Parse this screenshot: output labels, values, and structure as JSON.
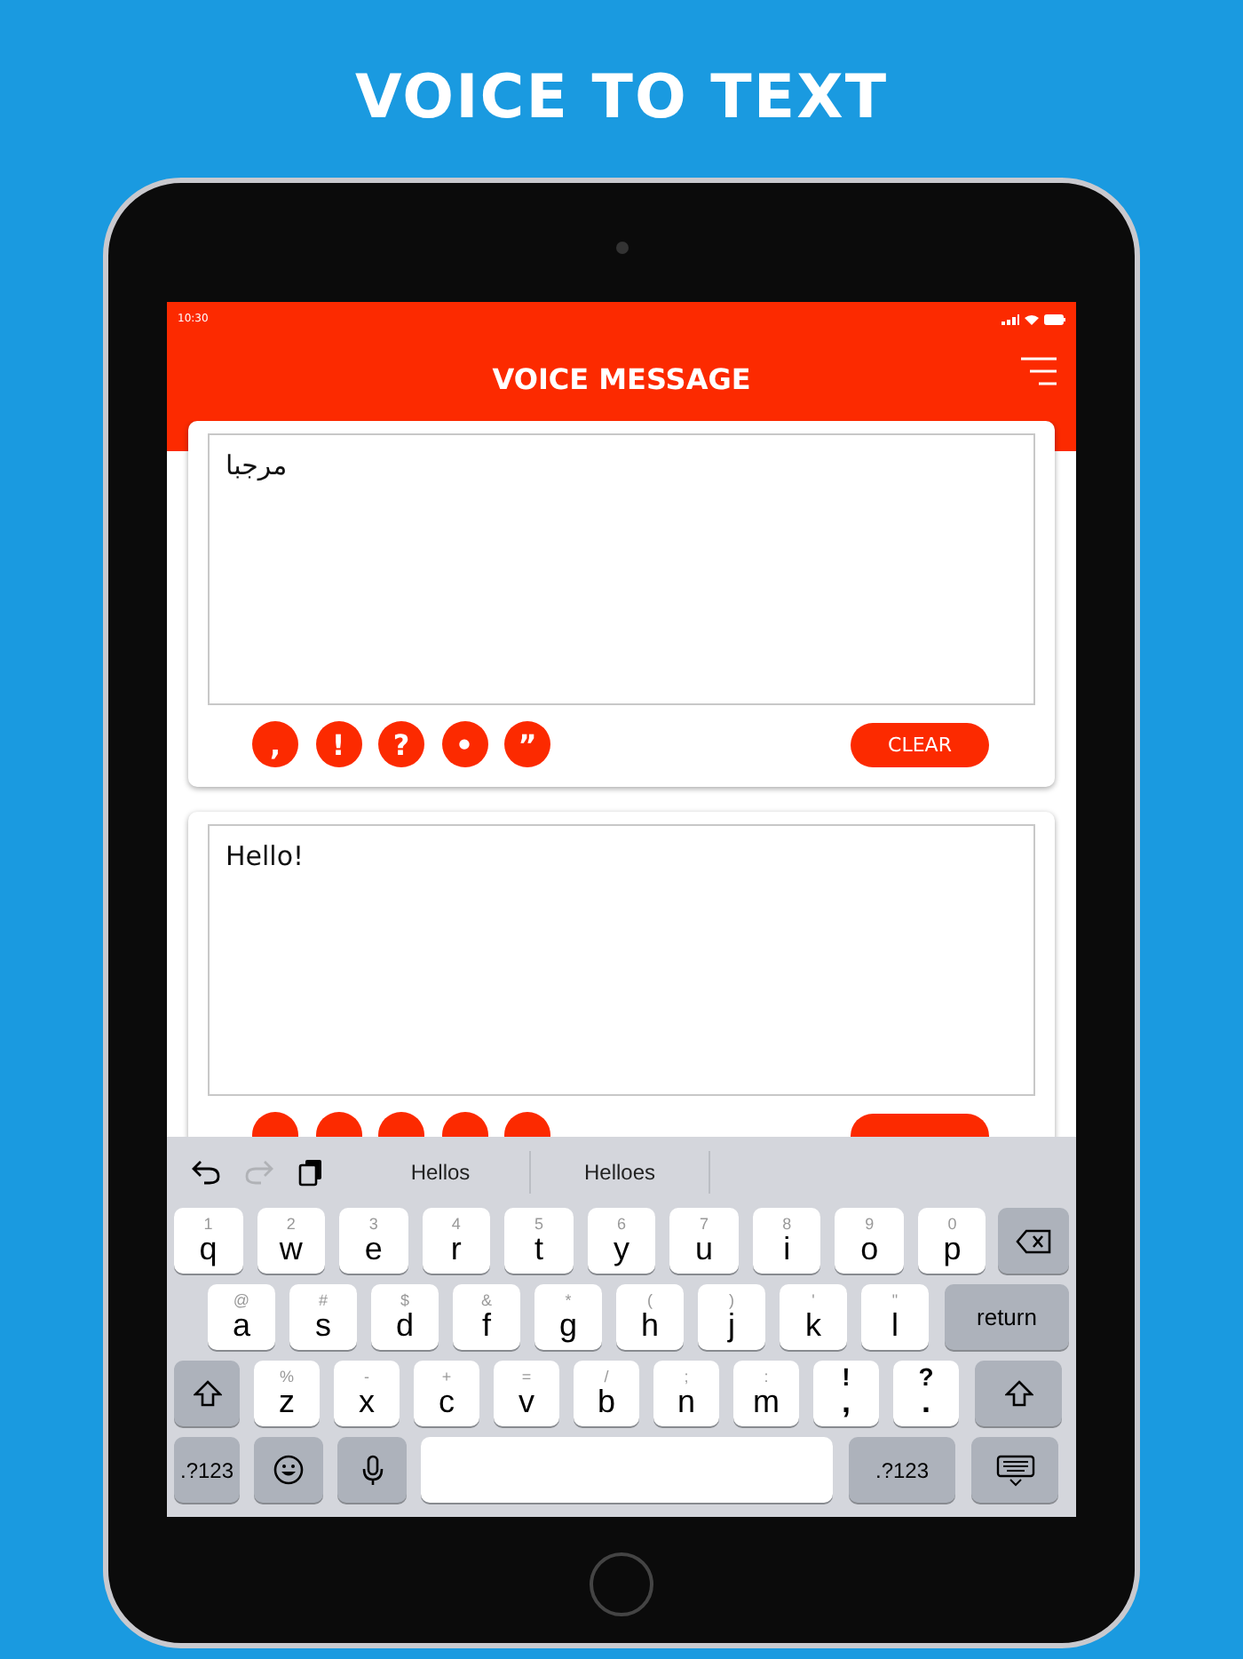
{
  "headline": "VOICE TO TEXT",
  "status_bar": {
    "time": "10:30"
  },
  "header": {
    "title": "VOICE MESSAGE"
  },
  "cards": [
    {
      "text": "مرجبا",
      "punctuation": [
        ",",
        "!",
        "?",
        "•",
        "”"
      ],
      "clear": "CLEAR"
    },
    {
      "text": "Hello!",
      "covered_buttons": [
        {
          "kind": "punctuation"
        },
        {
          "kind": "punctuation"
        },
        {
          "kind": "punctuation"
        },
        {
          "kind": "punctuation"
        },
        {
          "kind": "punctuation"
        },
        {
          "kind": "clear"
        }
      ]
    }
  ],
  "keyboard": {
    "undo_enabled": true,
    "redo_enabled": false,
    "suggestions": [
      "Hellos",
      "Helloes"
    ],
    "rows": [
      [
        {
          "kind": "letter",
          "label": "q",
          "hint": "1"
        },
        {
          "kind": "letter",
          "label": "w",
          "hint": "2"
        },
        {
          "kind": "letter",
          "label": "e",
          "hint": "3"
        },
        {
          "kind": "letter",
          "label": "r",
          "hint": "4"
        },
        {
          "kind": "letter",
          "label": "t",
          "hint": "5"
        },
        {
          "kind": "letter",
          "label": "y",
          "hint": "6"
        },
        {
          "kind": "letter",
          "label": "u",
          "hint": "7"
        },
        {
          "kind": "letter",
          "label": "i",
          "hint": "8"
        },
        {
          "kind": "letter",
          "label": "o",
          "hint": "9"
        },
        {
          "kind": "letter",
          "label": "p",
          "hint": "0"
        },
        {
          "kind": "delete"
        }
      ],
      [
        {
          "kind": "letter",
          "label": "a",
          "hint": "@"
        },
        {
          "kind": "letter",
          "label": "s",
          "hint": "#"
        },
        {
          "kind": "letter",
          "label": "d",
          "hint": "$"
        },
        {
          "kind": "letter",
          "label": "f",
          "hint": "&"
        },
        {
          "kind": "letter",
          "label": "g",
          "hint": "*"
        },
        {
          "kind": "letter",
          "label": "h",
          "hint": "("
        },
        {
          "kind": "letter",
          "label": "j",
          "hint": ")"
        },
        {
          "kind": "letter",
          "label": "k",
          "hint": "'"
        },
        {
          "kind": "letter",
          "label": "l",
          "hint": "\""
        },
        {
          "kind": "return",
          "label": "return"
        }
      ],
      [
        {
          "kind": "shift"
        },
        {
          "kind": "letter",
          "label": "z",
          "hint": "%"
        },
        {
          "kind": "letter",
          "label": "x",
          "hint": "-"
        },
        {
          "kind": "letter",
          "label": "c",
          "hint": "+"
        },
        {
          "kind": "letter",
          "label": "v",
          "hint": "="
        },
        {
          "kind": "letter",
          "label": "b",
          "hint": "/"
        },
        {
          "kind": "letter",
          "label": "n",
          "hint": ";"
        },
        {
          "kind": "letter",
          "label": "m",
          "hint": ":"
        },
        {
          "kind": "punct",
          "label": ",",
          "hint": "!"
        },
        {
          "kind": "punct",
          "label": ".",
          "hint": "?"
        },
        {
          "kind": "shift"
        }
      ],
      [
        {
          "kind": "numbers",
          "label": ".?123"
        },
        {
          "kind": "emoji"
        },
        {
          "kind": "mic"
        },
        {
          "kind": "space"
        },
        {
          "kind": "numbers",
          "label": ".?123"
        },
        {
          "kind": "hide"
        }
      ]
    ]
  }
}
